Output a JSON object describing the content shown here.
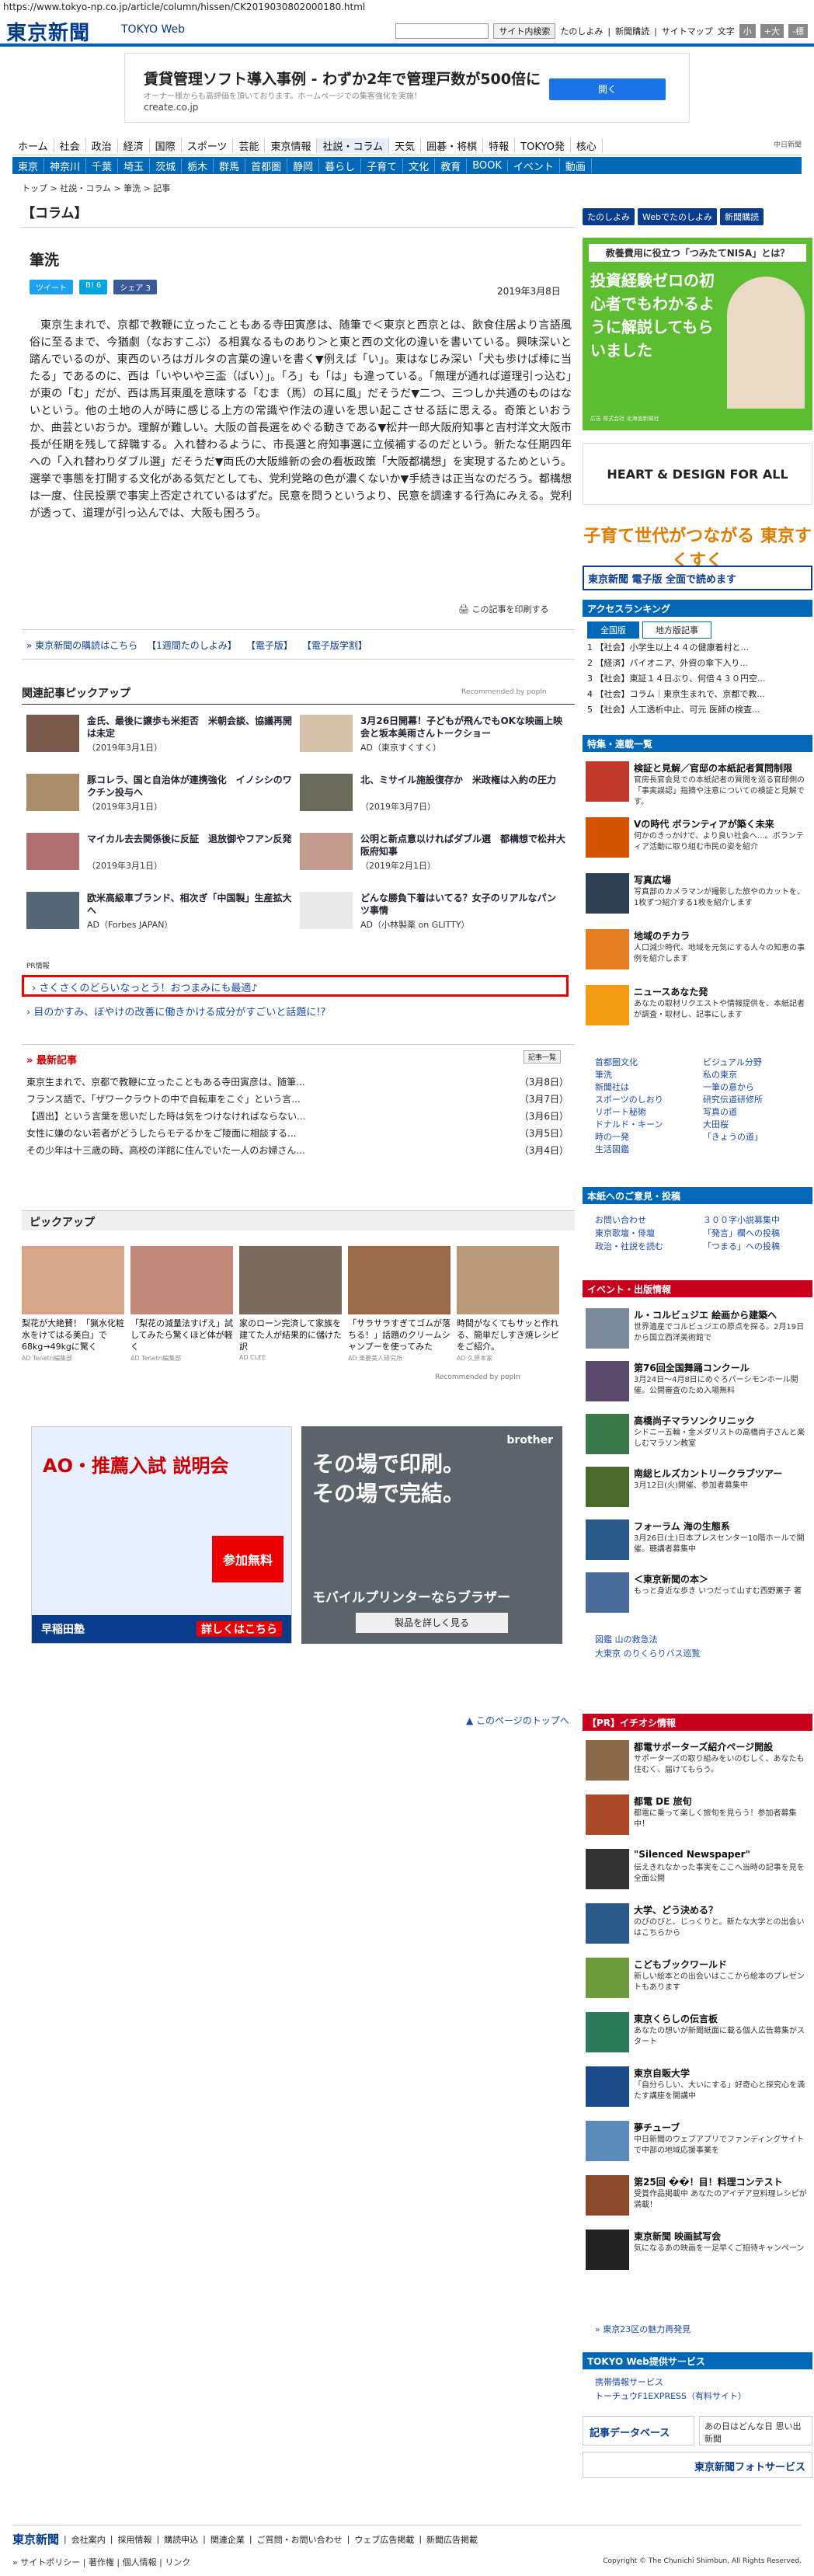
{
  "url": "https://www.tokyo-np.co.jp/article/column/hissen/CK2019030802000180.html",
  "header": {
    "logo": "東京新聞",
    "logo_sub": "TOKYO Web",
    "search_button": "サイト内検索",
    "links": [
      "たのしよみ",
      "新聞購読",
      "サイトマップ"
    ],
    "font_size_label": "文字",
    "font_sizes": [
      "小",
      "+大",
      "-標"
    ]
  },
  "ad_banner": {
    "title": "賃貸管理ソフト導入事例 - わずか2年で管理戸数が500倍に",
    "sub": "オーナー様からも高評価を頂いております。ホームページでの集客強化を実施！",
    "url": "create.co.jp",
    "button": "開く"
  },
  "nav1": [
    "ホーム",
    "社会",
    "政治",
    "経済",
    "国際",
    "スポーツ",
    "芸能",
    "東京情報",
    "社説・コラム",
    "天気",
    "囲碁・将棋",
    "特報",
    "TOKYO発",
    "核心"
  ],
  "nav1_brand": "中日新聞",
  "nav2": [
    "東京",
    "神奈川",
    "千葉",
    "埼玉",
    "茨城",
    "栃木",
    "群馬",
    "首都圏",
    "静岡",
    "暮らし",
    "子育て",
    "文化",
    "教育",
    "BOOK",
    "イベント",
    "動画"
  ],
  "breadcrumb": "トップ > 社説・コラム > 筆洗 > 記事",
  "section_title": "【コラム】",
  "article": {
    "title": "筆洗",
    "share": [
      "ツイート",
      "B! 6",
      "シェア 3"
    ],
    "date": "2019年3月8日",
    "body": "東京生まれで、京都で教鞭に立ったこともある寺田寅彦は、随筆で＜東京と西京とは、飲食住居より言語風俗に至るまで、今猶劇（なおすこぶ）る相異なるものあり＞と東と西の文化の違いを書いている。興味深いと踏んでいるのが、東西のいろはガルタの言葉の違いを書く▼例えば「い」。東はなじみ深い「犬も歩けば棒に当たる」であるのに、西は「いやいや三盃（ばい）」。「ろ」も「は」も違っている。「無理が通れば道理引っ込む」が東の「む」だが、西は馬耳東風を意味する「むま（馬）の耳に風」だそうだ▼二つ、三つしか共通のものはないという。他の土地の人が時に感じる上方の常識や作法の違いを思い起こさせる話に思える。奇策といおうか、曲芸といおうか。理解が難しい。大阪の首長選をめぐる動きである▼松井一郎大阪府知事と吉村洋文大阪市長が任期を残して辞職する。入れ替わるように、市長選と府知事選に立候補するのだという。新たな任期四年への「入れ替わりダブル選」だそうだ▼両氏の大阪維新の会の看板政策「大阪都構想」を実現するためという。選挙で事態を打開する文化がある気だとしても、党利党略の色が濃くないか▼手続きは正当なのだろう。都構想は一度、住民投票で事実上否定されているはずだ。民意を問うというより、民意を調達する行為にみえる。党利が透って、道理が引っ込んでは、大阪も困ろう。",
    "print_link": "この記事を印刷する"
  },
  "promo_links": [
    "東京新聞の購読はこちら",
    "【1週間たのしよみ】",
    "【電子版】",
    "【電子版学割】"
  ],
  "related": {
    "heading": "関連記事ピックアップ",
    "recommended": "Recommended by popIn",
    "items": [
      {
        "title": "金氏、最後に譲歩も米拒否　米朝会談、協議再開は未定",
        "date": "（2019年3月1日）",
        "color": "#7a5a4a"
      },
      {
        "title": "3月26日開幕！子どもが飛んでもOKな映画上映会と坂本美雨さんトークショー",
        "date": "AD（東京すくすく）",
        "color": "#d6c2a8"
      },
      {
        "title": "豚コレラ、国と自治体が連携強化　イノシシのワクチン投与へ",
        "date": "（2019年3月1日）",
        "color": "#aa8e6a"
      },
      {
        "title": "北、ミサイル施設復存か　米政権は入約の圧力",
        "date": "（2019年3月7日）",
        "color": "#6a6a5a"
      },
      {
        "title": "マイカル去去関係後に反証　退放御やフアン反発",
        "date": "（2019年3月1日）",
        "color": "#b07070"
      },
      {
        "title": "公明と新点意以ければダブル選　都構想で松井大阪府知事",
        "date": "（2019年2月1日）",
        "color": "#c09a8a"
      },
      {
        "title": "欧米高級車ブランド、相次ぎ「中国製」生産拡大へ",
        "date": "AD（Forbes JAPAN）",
        "color": "#556677"
      },
      {
        "title": "どんな勝負下着はいてる？女子のリアルなパンツ事情",
        "date": "AD（小林製薬 on GLITTY）",
        "color": "#e8e8e8"
      }
    ]
  },
  "pr": {
    "label": "PR情報",
    "line1": "さくさくのどらいなっとう！おつまみにも最適♪",
    "line2": "目のかすみ、ぼやけの改善に働きかける成分がすごいと話題に!?"
  },
  "latest": {
    "heading": "最新記事",
    "button": "記事一覧",
    "items": [
      {
        "title": "東京生まれで、京都で教鞭に立ったこともある寺田寅彦は、随筆...",
        "date": "（3月8日）"
      },
      {
        "title": "フランス語で、「ザワークラウトの中で自転車をこぐ」という言...",
        "date": "（3月7日）"
      },
      {
        "title": "【週出】という言葉を思いだした時は気をつけなければならない...",
        "date": "（3月6日）"
      },
      {
        "title": "女性に嫌のない若者がどうしたらモテるかをご陵面に相談する...",
        "date": "（3月5日）"
      },
      {
        "title": "その少年は十三歳の時、高校の洋館に住んでいた一人のお婦さん...",
        "date": "（3月4日）"
      }
    ]
  },
  "pickup": {
    "heading": "ピックアップ",
    "items": [
      {
        "title": "梨花が大絶賛！「猟水化粧水をけてはる美白」で68kg→49kgに驚く",
        "ad": "AD Tenetri編集部",
        "color": "#d7a58a"
      },
      {
        "title": "「梨花の減量法すげえ」試してみたら驚くほど体が軽く",
        "ad": "AD Tenetri編集部",
        "color": "#c18a7a"
      },
      {
        "title": "家のローン完済して家族を建てた人が結果的に儲けた訳",
        "ad": "AD CLEE",
        "color": "#7a6a5a"
      },
      {
        "title": "「サラサラすぎてゴムが落ちる！」話題のクリームシャンプーを使ってみた",
        "ad": "AD 楽要美人研究所",
        "color": "#9a6a4a"
      },
      {
        "title": "時間がなくてもサッと作れる、簡単だしすき焼レシピをご紹介。",
        "ad": "AD 久原本家",
        "color": "#b89a7a"
      }
    ],
    "recommended": "Recommended by popIn"
  },
  "ads": {
    "ad_left_title": "AO・推薦入試 説明会",
    "ad_left_sub": "参加無料",
    "ad_left_brand": "早稲田塾",
    "ad_left_btn": "詳しくはこちら",
    "ad_right_title": "その場で印刷。その場で完結。",
    "ad_right_sub": "モバイルプリンターならブラザー",
    "ad_right_btn": "製品を詳しく見る",
    "ad_right_brand": "brother"
  },
  "page_top": "このページのトップへ",
  "sidebar": {
    "buttons": [
      "たのしよみ",
      "Webでたのしよみ",
      "新聞購読"
    ],
    "nisa_head": "教養費用に役立つ「つみたてNISA」とは？",
    "nisa_body": "投資経験ゼロの初心者でもわかるように解説してもらいました",
    "nisa_foot": "広告 株式会社 北海道新聞社",
    "heart": "HEART & DESIGN FOR ALL",
    "sugusuku": "子育て世代がつながる 東京すくすく",
    "denshi": "東京新聞 電子版 全面で読めます",
    "ranking_head": "アクセスランキング",
    "ranking_tabs": [
      "全国版",
      "地方版記事"
    ],
    "ranking": [
      "【社会】小学生以上４４の健康着村と...",
      "【経済】パイオニア、外資の傘下入り...",
      "【社会】東証１４日ぶり、何倍４３０円空...",
      "【社会】コラム｜東京生まれで、京都で教...",
      "【社会】人工透析中止、可元 医師の検査..."
    ],
    "special_head": "特集・連載一覧",
    "specials": [
      {
        "title": "検証と見解／官邸の本紙記者質問制限",
        "desc": "官房長官会見での本紙記者の質問を巡る官邸側の「事実誤認」指摘や注意についての検証と見解です。",
        "color": "#c0392b"
      },
      {
        "title": "Vの時代 ボランティアが築く未来",
        "desc": "何かのきっかけで、より良い社会へ…。ボランティア活動に取り組む市民の姿を紹介",
        "color": "#d35400"
      },
      {
        "title": "写真広場",
        "desc": "写真部のカメラマンが撮影した旅やのカットを、1枚ずつ紹介する1枚を紹介します",
        "color": "#2c3e50"
      },
      {
        "title": "地域のチカラ",
        "desc": "人口減少時代、地域を元気にする人々の知恵の事例を紹介します",
        "color": "#e67e22"
      },
      {
        "title": "ニュースあなた発",
        "desc": "あなたの取材リクエストや情報提供を、本紙記者が調査・取材し、記事にします",
        "color": "#f39c12"
      }
    ],
    "links": [
      "首都圏文化",
      "ビジュアル分野",
      "筆洗",
      "私の東京",
      "新聞社は",
      "一筆の意から",
      "スポーツのしおり",
      "研究伝道研修所",
      "リポート秘術",
      "写真の道",
      "ドナルド・キーン",
      "大田桜",
      "時の一発",
      "「きょうの道」",
      "生活図鑑"
    ],
    "hon_head": "本紙へのご意見・投稿",
    "hon_links": [
      "お問い合わせ",
      "３００字小説募集中",
      "東京歌壇・俳壇",
      "「発言」欄への投稿",
      "政治・社説を読む",
      "「つまる」への投稿"
    ],
    "event_head": "イベント・出版情報",
    "events": [
      {
        "title": "ル・コルビュジエ 絵画から建築へ",
        "desc": "世界遺産でコルビュジエの原点を探る。2月19日から国立西洋美術館で",
        "color": "#7a8a9a"
      },
      {
        "title": "第76回全国舞踊コンクール",
        "desc": "3月24日〜4月8日にめぐろパーシモンホール開催。公開審査のため入場無料",
        "color": "#5b4a6b"
      },
      {
        "title": "高橋尚子マラソンクリニック",
        "desc": "シドニー五輪・金メダリストの高橋尚子さんと楽しむマラソン教室",
        "color": "#3a7a4a"
      },
      {
        "title": "南総ヒルズカントリークラブツアー",
        "desc": "3月12日(火)開催、参加者募集中",
        "color": "#4a6a2a"
      },
      {
        "title": "フォーラム 海の生態系",
        "desc": "3月26日(土)日本プレスセンター10階ホールで開催。聴講者募集中",
        "color": "#2a5a8a"
      },
      {
        "title": "＜東京新聞の本＞",
        "desc": "もっと身近な歩き いつだって山すむ西野薫子 著",
        "color": "#4a6a9a"
      }
    ],
    "event_links": [
      "図鑑 山の救急法",
      "大東京 のりくらりバス巡覧"
    ],
    "iene_head": "【PR】イチオシ情報",
    "iene": [
      {
        "title": "都電サポーターズ紹介ページ開設",
        "desc": "サポーターズの取り組みをいのむしく、あなたも住むく、届けてもらう。",
        "color": "#8a6a4a"
      },
      {
        "title": "都電 DE 旅旬",
        "desc": "都電に乗って楽しく旅旬を見らう！参加者募集中！",
        "color": "#aa4a2a"
      },
      {
        "title": "\"Silenced Newspaper\"",
        "desc": "伝えきれなかった事実をここへ当時の記事を見を全面公開",
        "color": "#333"
      },
      {
        "title": "大学、どう決める？",
        "desc": "のびのびと、じっくりと。新たな大学との出会いはこちらから",
        "color": "#2a5a8a"
      },
      {
        "title": "こどもブックワールド",
        "desc": "新しい絵本との出会いはここから絵本のプレゼントもあります",
        "color": "#6a9a3a"
      },
      {
        "title": "東京くらしの伝言板",
        "desc": "あなたの想いが新聞紙面に載る個人広告募集がスタート",
        "color": "#2a7a5a"
      },
      {
        "title": "東京自販大学",
        "desc": "「自分らしい、大いにする」好奇心と探究心を満たす講座を開講中",
        "color": "#1a4a8a"
      },
      {
        "title": "夢チューブ",
        "desc": "中日新聞のウェブアプリでファンディングサイトで中部の地域応援事業を",
        "color": "#5a8aba"
      },
      {
        "title": "第25回 ��！目！料理コンテスト",
        "desc": "受賞作品掲載中 あなたのアイデア豆料理レシピが満載！",
        "color": "#8a4a2a"
      },
      {
        "title": "東京新聞 映画試写会",
        "desc": "気になるあの映画を一足早くご招待キャンペーン",
        "color": "#222"
      }
    ],
    "iene_link": "東京23区の魅力再発見",
    "svc_head": "TOKYO Web提供サービス",
    "svc": [
      "携帯情報サービス",
      "トーチュウF1EXPRESS（有料サイト）"
    ],
    "bottom1": "記事データベース",
    "bottom2": "あの日はどんな日 思い出新聞",
    "bottom3": "東京新聞フォトサービス"
  },
  "footer": {
    "logo": "東京新聞",
    "links1": [
      "会社案内",
      "採用情報",
      "購読申込",
      "関連企業",
      "ご質問・お問い合わせ",
      "ウェブ広告掲載",
      "新聞広告掲載"
    ],
    "links2": [
      "サイトポリシー",
      "著作権",
      "個人情報",
      "リンク"
    ],
    "copyright": "Copyright © The Chunichi Shimbun, All Rights Reserved."
  }
}
